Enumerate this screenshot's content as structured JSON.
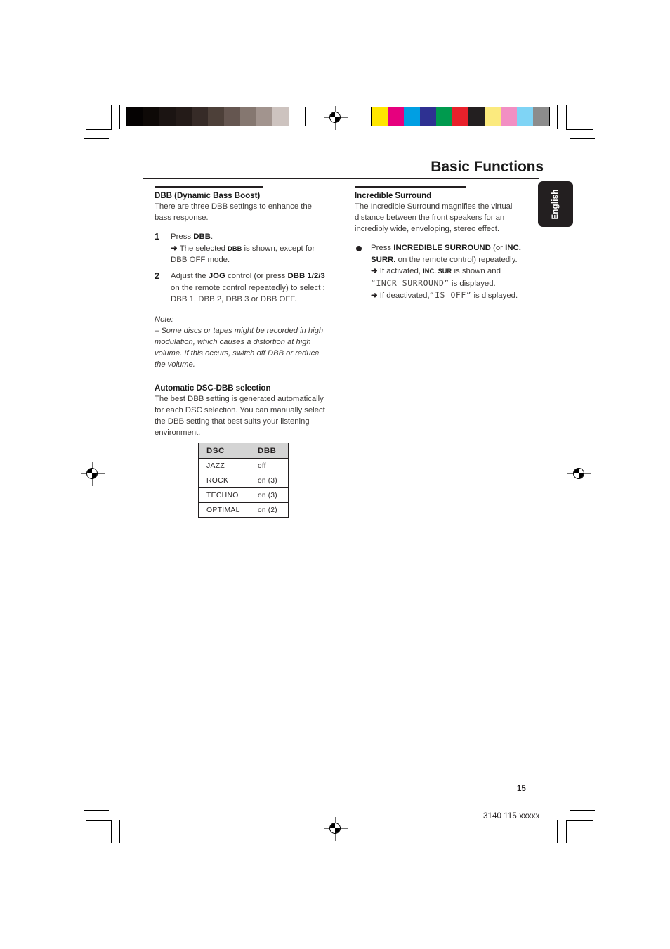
{
  "header": {
    "title": "Basic Functions",
    "language_tab": "English"
  },
  "left_column": {
    "section1": {
      "heading": "DBB (Dynamic Bass Boost)",
      "intro": "There are three DBB settings to enhance the bass response.",
      "steps": [
        {
          "marker": "1",
          "text_parts": [
            {
              "t": "Press ",
              "style": "normal"
            },
            {
              "t": "DBB",
              "style": "bold"
            },
            {
              "t": ".",
              "style": "normal"
            }
          ],
          "results": [
            {
              "arrow": "➜",
              "parts": [
                {
                  "t": "The selected ",
                  "style": "normal"
                },
                {
                  "t": "DBB",
                  "style": "indicator"
                },
                {
                  "t": " is shown, except for DBB OFF mode.",
                  "style": "normal"
                }
              ]
            }
          ]
        },
        {
          "marker": "2",
          "text_parts": [
            {
              "t": "Adjust the ",
              "style": "normal"
            },
            {
              "t": "JOG",
              "style": "bold"
            },
            {
              "t": " control (or press ",
              "style": "normal"
            },
            {
              "t": "DBB 1/2/3",
              "style": "bold"
            },
            {
              "t": " on the remote control repeatedly) to select : DBB 1, DBB 2, DBB 3 or DBB OFF.",
              "style": "normal"
            }
          ],
          "results": []
        }
      ],
      "note": {
        "label": "Note:",
        "text": "–  Some discs or tapes might be recorded in high modulation, which causes a distortion at high volume. If this occurs, switch off DBB or reduce the volume."
      }
    },
    "section2": {
      "heading": "Automatic DSC-DBB selection",
      "body": "The best DBB setting is generated automatically for each DSC selection. You can manually select the DBB setting that best suits your listening environment."
    },
    "table": {
      "columns": [
        "DSC",
        "DBB"
      ],
      "rows": [
        [
          "JAZZ",
          "off"
        ],
        [
          "ROCK",
          "on (3)"
        ],
        [
          "TECHNO",
          "on (3)"
        ],
        [
          "OPTIMAL",
          "on (2)"
        ]
      ]
    }
  },
  "right_column": {
    "section1": {
      "heading": "Incredible Surround",
      "intro": "The Incredible Surround magnifies the virtual distance between the front speakers for an incredibly wide, enveloping, stereo effect.",
      "bullet": {
        "marker": "●",
        "text_parts": [
          {
            "t": "Press ",
            "style": "normal"
          },
          {
            "t": "INCREDIBLE SURROUND",
            "style": "bold"
          },
          {
            "t": " (or ",
            "style": "normal"
          },
          {
            "t": "INC. SURR.",
            "style": "bold"
          },
          {
            "t": " on the remote control) repeatedly.",
            "style": "normal"
          }
        ],
        "results": [
          {
            "arrow": "➜",
            "parts": [
              {
                "t": "If activated, ",
                "style": "normal"
              },
              {
                "t": "INC. SUR",
                "style": "indicator"
              },
              {
                "t": " is shown and ",
                "style": "normal"
              },
              {
                "t": "“INCR SURROUND”",
                "style": "lcd"
              },
              {
                "t": " is displayed.",
                "style": "normal"
              }
            ]
          },
          {
            "arrow": "➜",
            "parts": [
              {
                "t": "If deactivated,",
                "style": "normal"
              },
              {
                "t": "“IS OFF”",
                "style": "lcd"
              },
              {
                "t": " is displayed.",
                "style": "normal"
              }
            ]
          }
        ]
      }
    }
  },
  "footer": {
    "page_number": "15",
    "document_code": "3140 115 xxxxx"
  },
  "print_marks": {
    "grayscale_bar": [
      "#050202",
      "#0e0907",
      "#1b1412",
      "#241b18",
      "#362b27",
      "#4d4039",
      "#655650",
      "#857770",
      "#a2948e",
      "#cdc3bf",
      "#ffffff"
    ],
    "color_bar": [
      "#ffe600",
      "#e6007e",
      "#009fe3",
      "#2e3192",
      "#009a4e",
      "#e8212b",
      "#231f20",
      "#fbea7e",
      "#f28fc3",
      "#7fd4f5",
      "#8c8c8c"
    ],
    "registration_icon": "registration-target-icon"
  }
}
